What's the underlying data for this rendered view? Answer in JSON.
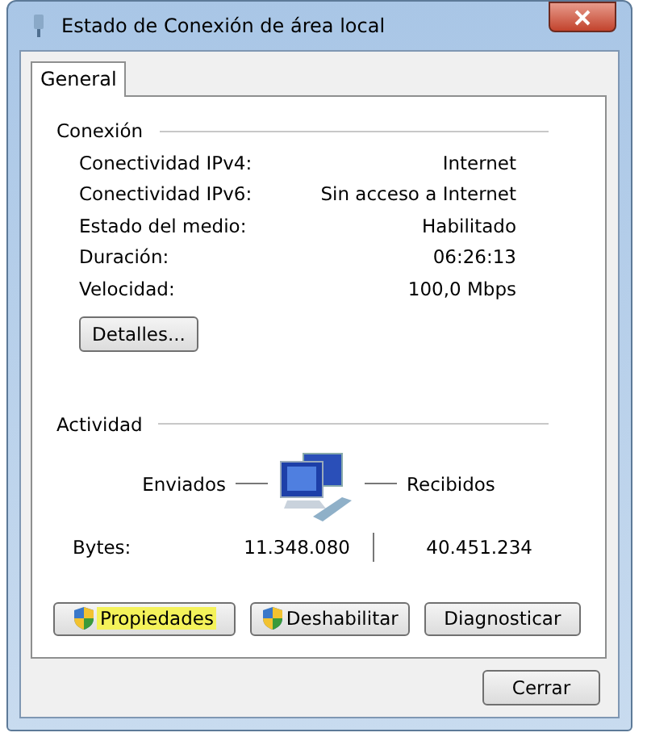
{
  "window": {
    "title": "Estado de Conexión de área local"
  },
  "tabs": [
    {
      "label": "General",
      "selected": true
    }
  ],
  "connection": {
    "title": "Conexión",
    "rows": [
      {
        "label": "Conectividad IPv4:",
        "value": "Internet"
      },
      {
        "label": "Conectividad IPv6:",
        "value": "Sin acceso a Internet"
      },
      {
        "label": "Estado del medio:",
        "value": "Habilitado"
      },
      {
        "label": "Duración:",
        "value": "06:26:13"
      },
      {
        "label": "Velocidad:",
        "value": "100,0 Mbps"
      }
    ],
    "details_button": "Detalles..."
  },
  "activity": {
    "title": "Actividad",
    "sent_label": "Enviados",
    "received_label": "Recibidos",
    "bytes_label": "Bytes:",
    "sent": "11.348.080",
    "received": "40.451.234"
  },
  "buttons": [
    {
      "label": "Propiedades",
      "kind": "shield",
      "highlighted": true
    },
    {
      "label": "Deshabilitar",
      "kind": "shield",
      "highlighted": false
    },
    {
      "label": "Diagnosticar",
      "kind": "plain",
      "highlighted": false
    }
  ],
  "close_button": "Cerrar"
}
